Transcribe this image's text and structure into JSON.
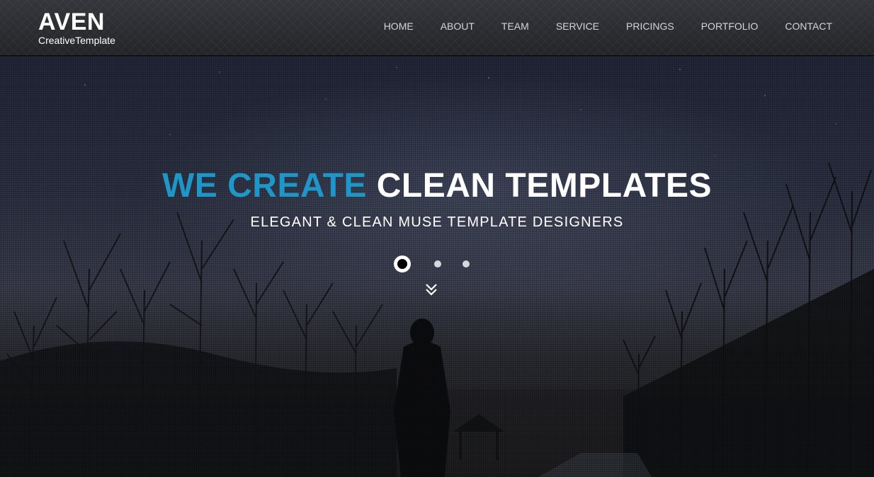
{
  "brand": {
    "title": "AVEN",
    "subtitle": "CreativeTemplate"
  },
  "nav": {
    "items": [
      {
        "label": "HOME"
      },
      {
        "label": "ABOUT"
      },
      {
        "label": "TEAM"
      },
      {
        "label": "SERVICE"
      },
      {
        "label": "PRICINGS"
      },
      {
        "label": "PORTFOLIO"
      },
      {
        "label": "CONTACT"
      }
    ]
  },
  "hero": {
    "headline_accent": "WE CREATE",
    "headline_main": "CLEAN TEMPLATES",
    "subheadline": "ELEGANT & CLEAN MUSE TEMPLATE DESIGNERS",
    "slider": {
      "count": 3,
      "active_index": 0
    },
    "scroll_icon": "double-chevron-down-icon"
  },
  "colors": {
    "accent": "#1e96c8",
    "header_bg": "#2b2c30",
    "text": "#ffffff",
    "nav_text": "#d4d5d8"
  }
}
